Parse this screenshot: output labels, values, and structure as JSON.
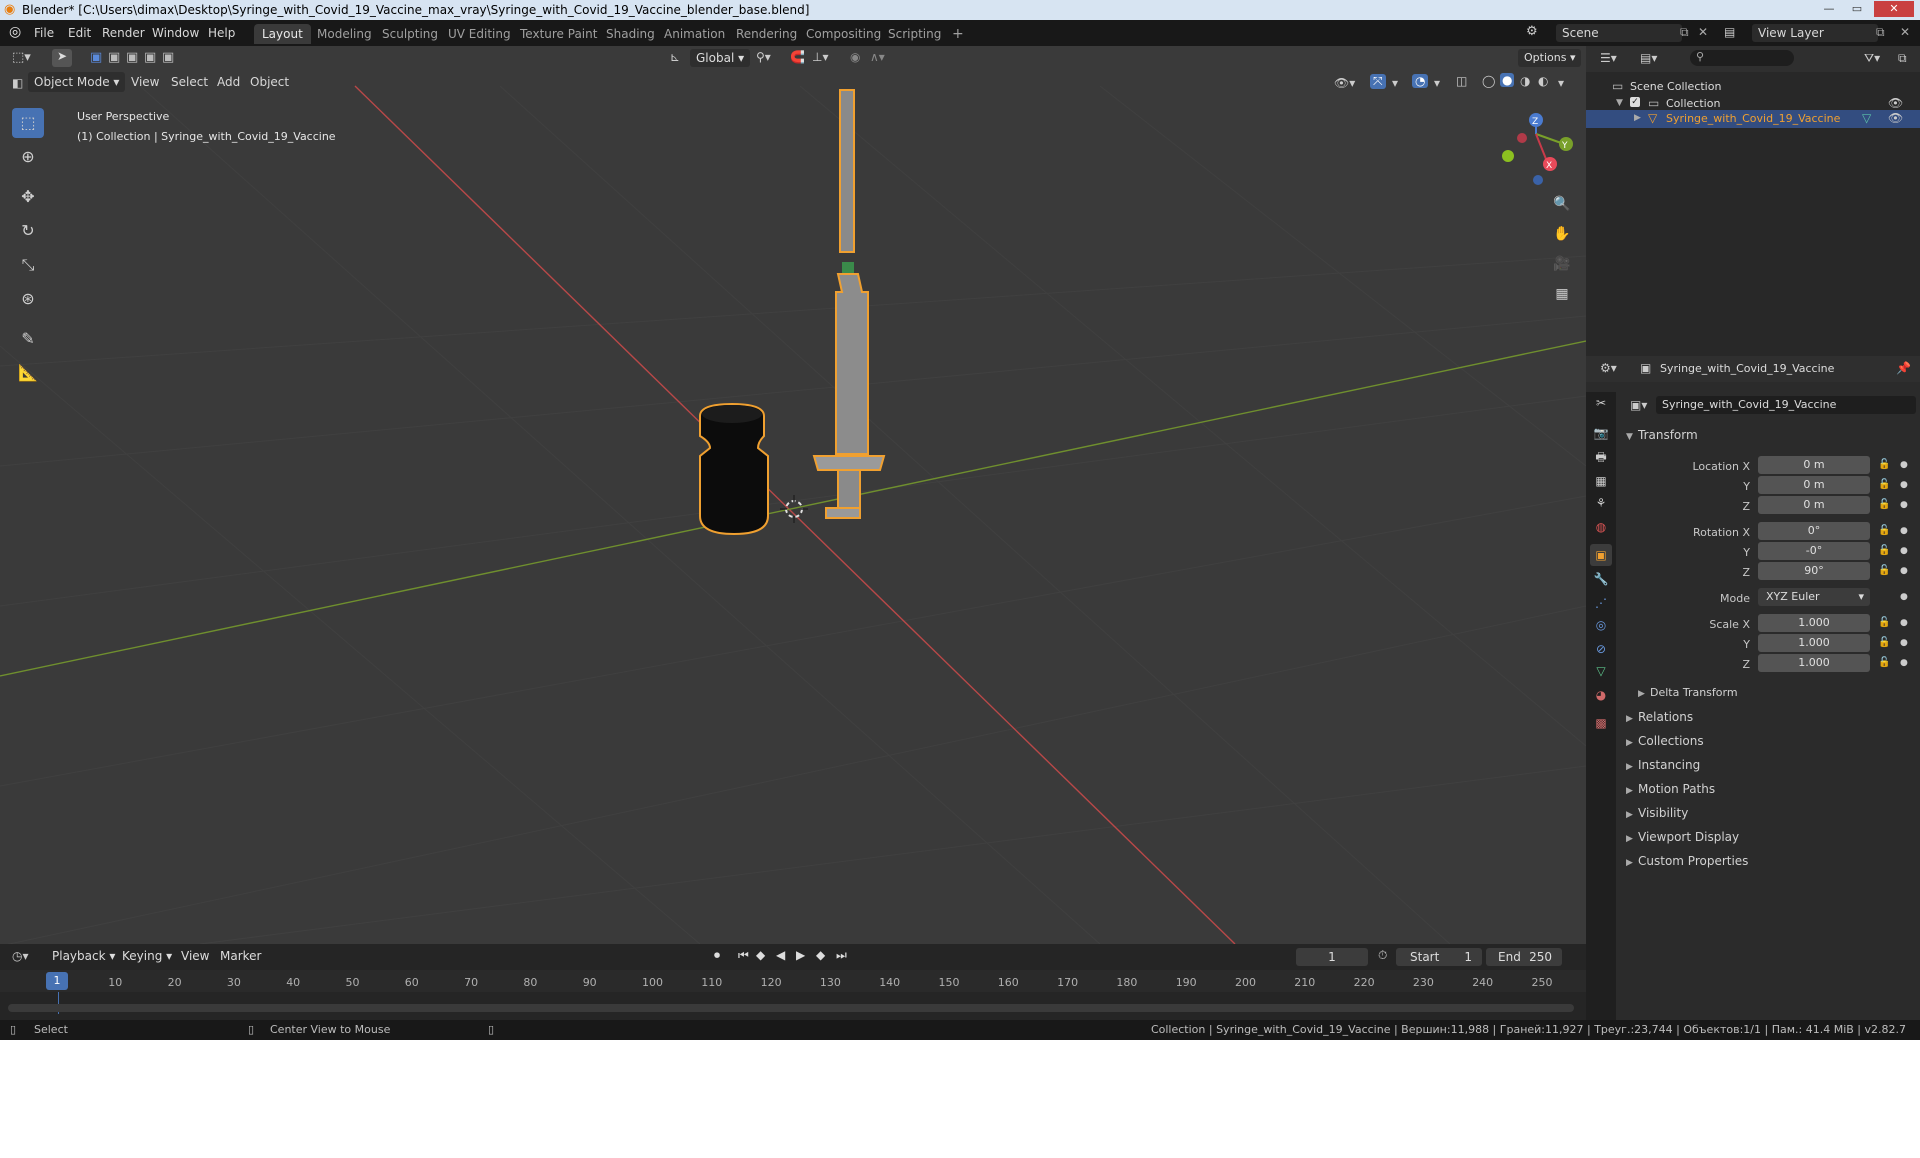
{
  "window": {
    "title": "Blender* [C:\\Users\\dimax\\Desktop\\Syringe_with_Covid_19_Vaccine_max_vray\\Syringe_with_Covid_19_Vaccine_blender_base.blend]",
    "minimize": "—",
    "maximize": "▭",
    "close": "✕"
  },
  "menubar": [
    "File",
    "Edit",
    "Render",
    "Window",
    "Help"
  ],
  "workspaces": [
    "Layout",
    "Modeling",
    "Sculpting",
    "UV Editing",
    "Texture Paint",
    "Shading",
    "Animation",
    "Rendering",
    "Compositing",
    "Scripting"
  ],
  "active_workspace": "Layout",
  "add_workspace": "+",
  "scene": {
    "label": "Scene",
    "view_layer": "View Layer"
  },
  "viewport": {
    "orientation": "Global",
    "options": "Options",
    "mode": "Object Mode",
    "menus": [
      "View",
      "Select",
      "Add",
      "Object"
    ],
    "overlay_line1": "User Perspective",
    "overlay_line2": "(1) Collection | Syringe_with_Covid_19_Vaccine",
    "gizmo": {
      "z": "Z",
      "y": "Y",
      "x": "X"
    },
    "colors": {
      "bg": "#3a3a3a",
      "x_axis": "#c84848",
      "y_axis": "#7a9a30",
      "selection": "#f0a030"
    }
  },
  "timeline": {
    "menus": [
      "Playback",
      "Keying",
      "View",
      "Marker"
    ],
    "current_frame": "1",
    "start_label": "Start",
    "start": "1",
    "end_label": "End",
    "end": "250",
    "ticks": [
      "1",
      "10",
      "20",
      "30",
      "40",
      "50",
      "60",
      "70",
      "80",
      "90",
      "100",
      "110",
      "120",
      "130",
      "140",
      "150",
      "160",
      "170",
      "180",
      "190",
      "200",
      "210",
      "220",
      "230",
      "240",
      "250"
    ]
  },
  "statusbar": {
    "left": "Select",
    "middle": "Center View to Mouse",
    "right": "Collection | Syringe_with_Covid_19_Vaccine | Вершин:11,988 | Граней:11,927 | Треуг.:23,744 | Объектов:1/1 | Пам.: 41.4 MiB | v2.82.7"
  },
  "outliner": {
    "root": "Scene Collection",
    "collection": "Collection",
    "object": "Syringe_with_Covid_19_Vaccine"
  },
  "properties": {
    "header_object": "Syringe_with_Covid_19_Vaccine",
    "name_field": "Syringe_with_Covid_19_Vaccine",
    "transform_title": "Transform",
    "location": {
      "label_x": "Location X",
      "label_y": "Y",
      "label_z": "Z",
      "x": "0 m",
      "y": "0 m",
      "z": "0 m"
    },
    "rotation": {
      "label_x": "Rotation X",
      "label_y": "Y",
      "label_z": "Z",
      "x": "0°",
      "y": "-0°",
      "z": "90°"
    },
    "mode": {
      "label": "Mode",
      "value": "XYZ Euler"
    },
    "scale": {
      "label_x": "Scale X",
      "label_y": "Y",
      "label_z": "Z",
      "x": "1.000",
      "y": "1.000",
      "z": "1.000"
    },
    "delta_transform": "Delta Transform",
    "sections": [
      "Relations",
      "Collections",
      "Instancing",
      "Motion Paths",
      "Visibility",
      "Viewport Display",
      "Custom Properties"
    ]
  }
}
